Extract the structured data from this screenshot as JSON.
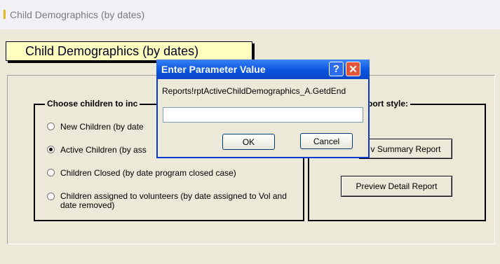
{
  "window": {
    "title": "Child Demographics (by dates)"
  },
  "form": {
    "heading": "Child Demographics (by dates)",
    "children_group": {
      "legend": "Choose children to inc",
      "options": [
        {
          "label": "New Children (by date",
          "selected": false
        },
        {
          "label": "Active Children (by ass",
          "selected": true
        },
        {
          "label": "Children Closed (by date program closed case)",
          "selected": false
        },
        {
          "label": "Children assigned to volunteers (by date assigned to Vol and date removed)",
          "selected": false
        }
      ]
    },
    "report_group": {
      "legend": "port style:",
      "summary_button": "v Summary Report",
      "detail_button": "Preview Detail Report"
    }
  },
  "dialog": {
    "title": "Enter Parameter Value",
    "help_glyph": "?",
    "close_glyph": "✕",
    "prompt": "Reports!rptActiveChildDemographics_A.GetdEnd",
    "input_value": "",
    "ok_label": "OK",
    "cancel_label": "Cancel"
  }
}
